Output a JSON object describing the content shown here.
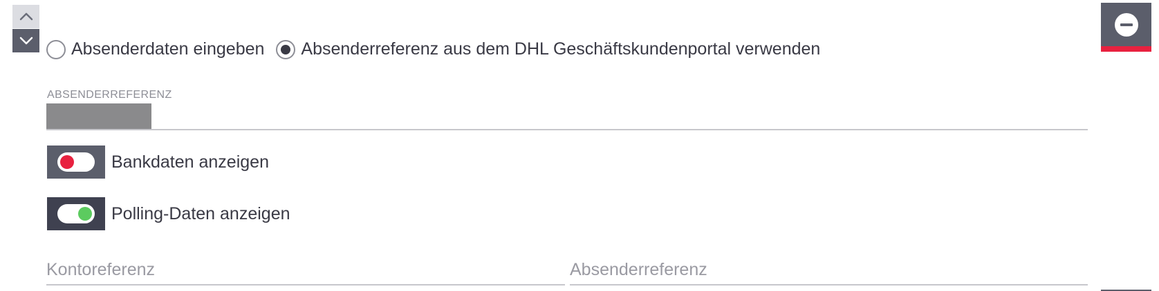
{
  "controls": {
    "move_up_icon": "chevron-up-icon",
    "move_down_icon": "chevron-down-icon",
    "remove_icon": "minus-circle-icon"
  },
  "sender_mode": {
    "options": [
      {
        "label": "Absenderdaten eingeben",
        "checked": false
      },
      {
        "label": "Absenderreferenz aus dem DHL Geschäftskundenportal verwenden",
        "checked": true
      }
    ]
  },
  "sender_reference": {
    "label": "ABSENDERREFERENZ"
  },
  "toggles": {
    "bank": {
      "label": "Bankdaten anzeigen",
      "state": "off"
    },
    "polling": {
      "label": "Polling-Daten anzeigen",
      "state": "on"
    }
  },
  "inputs": {
    "account_reference": {
      "placeholder": "Kontoreferenz",
      "value": ""
    },
    "sender_reference": {
      "placeholder": "Absenderreferenz",
      "value": ""
    }
  },
  "colors": {
    "accent_red": "#e8213f",
    "toggle_on_green": "#5ccb5f",
    "control_gray": "#5b5e6b",
    "text": "#3a3a45",
    "muted_text": "#8d8e96"
  }
}
